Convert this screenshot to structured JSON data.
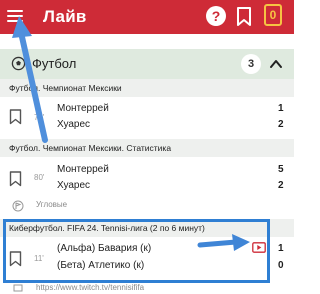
{
  "header": {
    "title": "Лайв",
    "help_icon": "help-icon",
    "bookmark_icon": "bookmark-icon",
    "coupon_icon": "coupon-icon",
    "coupon_count": "0",
    "bg_color": "#ce2b37"
  },
  "sport": {
    "name": "Футбол",
    "count": "3",
    "icon": "football-icon",
    "bg_color": "#dfeadf"
  },
  "leagues": [
    {
      "name": "Футбол. Чемпионат Мексики",
      "time": "79'",
      "team1": "Монтеррей",
      "team2": "Хуарес",
      "score1": "1",
      "score2": "2"
    },
    {
      "name": "Футбол. Чемпионат Мексики. Статистика",
      "time": "80'",
      "team1": "Монтеррей",
      "team2": "Хуарес",
      "score1": "5",
      "score2": "2",
      "subline": "Угловые"
    },
    {
      "name": "Киберфутбол. FIFA 24. Tennisi-лига (2 по 6 минут)",
      "time": "11'",
      "team1": "(Альфа) Бавария (к)",
      "team2": "(Бета) Атлетико (к)",
      "score1": "1",
      "score2": "0",
      "subline": "https://www.twitch.tv/tennisififa"
    }
  ],
  "colors": {
    "highlight": "#2f7fd3",
    "accent": "#ce2b37"
  }
}
